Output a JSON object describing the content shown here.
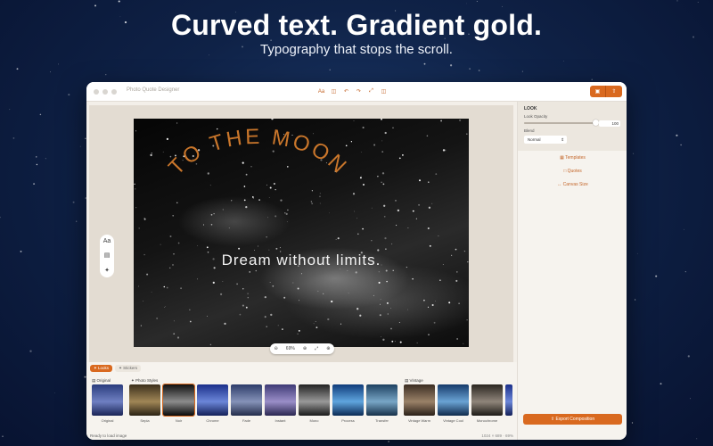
{
  "headline": "Curved text. Gradient gold.",
  "subheadline": "Typography that stops the scroll.",
  "window": {
    "title": "Photo Quote Designer",
    "toolbar_icons": [
      "text-format-icon",
      "sidebar-toggle-icon",
      "undo-icon",
      "redo-icon",
      "resize-icon",
      "panel-icon"
    ],
    "right_buttons": [
      "photos-icon",
      "share-icon"
    ]
  },
  "canvas": {
    "curved_text": "TO THE MOON",
    "quote_text": "Dream without limits.",
    "zoom_level": "69%",
    "curved_text_color": "#c9762b"
  },
  "side_tools": [
    "Aa",
    "image-icon",
    "sparkle-icon"
  ],
  "panel": {
    "section_title": "LOOK",
    "opacity_label": "Look Opacity",
    "opacity_value": "100",
    "opacity_fraction": 1.0,
    "blend_label": "Blend",
    "blend_value": "Normal",
    "links": [
      "Templates",
      "Quotes",
      "Canvas Size"
    ],
    "export_label": "Export Composition"
  },
  "bottom": {
    "tabs": [
      "Looks",
      "Stickers"
    ],
    "sections": [
      "Original",
      "Photo Styles",
      "Vintage"
    ],
    "thumbnails": [
      "Original",
      "Sepia",
      "Noir",
      "Chrome",
      "Fade",
      "Instant",
      "Mono",
      "Process",
      "Transfer",
      "Vintage Warm",
      "Vintage Cool",
      "Monochrome"
    ],
    "selected_thumbnail": "Noir"
  },
  "status": {
    "left": "Ready to load image",
    "right": "1024 × 689 · 69%"
  },
  "colors": {
    "accent": "#d9691f"
  }
}
